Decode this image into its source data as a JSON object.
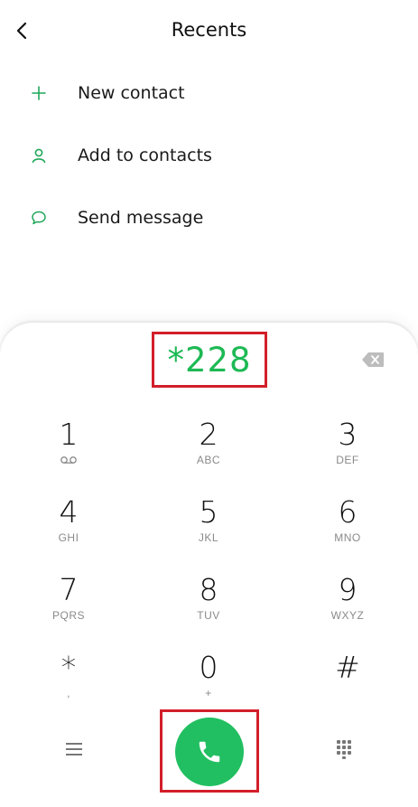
{
  "header": {
    "title": "Recents"
  },
  "actions": [
    {
      "label": "New contact",
      "icon": "plus-icon"
    },
    {
      "label": "Add to contacts",
      "icon": "person-icon"
    },
    {
      "label": "Send message",
      "icon": "message-bubble-icon"
    }
  ],
  "dialer": {
    "number": "*228",
    "keys": [
      {
        "digit": "1",
        "letters": ""
      },
      {
        "digit": "2",
        "letters": "ABC"
      },
      {
        "digit": "3",
        "letters": "DEF"
      },
      {
        "digit": "4",
        "letters": "GHI"
      },
      {
        "digit": "5",
        "letters": "JKL"
      },
      {
        "digit": "6",
        "letters": "MNO"
      },
      {
        "digit": "7",
        "letters": "PQRS"
      },
      {
        "digit": "8",
        "letters": "TUV"
      },
      {
        "digit": "9",
        "letters": "WXYZ"
      },
      {
        "digit": "*",
        "letters": ","
      },
      {
        "digit": "0",
        "letters": "+"
      },
      {
        "digit": "#",
        "letters": ""
      }
    ]
  },
  "colors": {
    "accent": "#21bf61",
    "number_text": "#1db954",
    "highlight_border": "#d21f2a",
    "icon_green": "#1fa75a"
  }
}
